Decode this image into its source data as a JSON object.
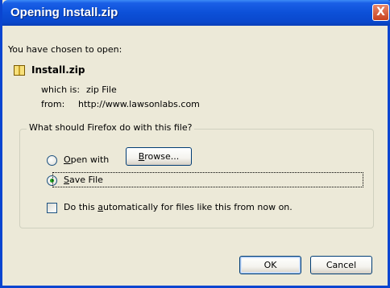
{
  "window": {
    "title": "Opening Install.zip"
  },
  "title_controls": {
    "close_glyph": "X"
  },
  "intro": {
    "chosen_label": "You have chosen to open:"
  },
  "file": {
    "icon": "zip-file-icon",
    "name": "Install.zip",
    "type_label": "which is:",
    "type_value": "zip File",
    "from_label": "from:",
    "from_value": "http://www.lawsonlabs.com"
  },
  "action_group": {
    "legend": "What should Firefox do with this file?",
    "open_with": {
      "hotkey": "O",
      "label_rest": "pen with",
      "selected": false
    },
    "browse_button": {
      "hotkey": "B",
      "label_rest": "rowse..."
    },
    "save_file": {
      "hotkey": "S",
      "label_rest": "ave File",
      "selected": true
    },
    "auto_checkbox": {
      "label_before": "Do this ",
      "hotkey": "a",
      "label_after": "utomatically for files like this from now on.",
      "checked": false
    }
  },
  "buttons": {
    "ok": "OK",
    "cancel": "Cancel"
  },
  "colors": {
    "title_bar": "#0a48cc",
    "dialog_bg": "#ece9d8",
    "close_button": "#c8411e",
    "radio_dot": "#21a121"
  }
}
